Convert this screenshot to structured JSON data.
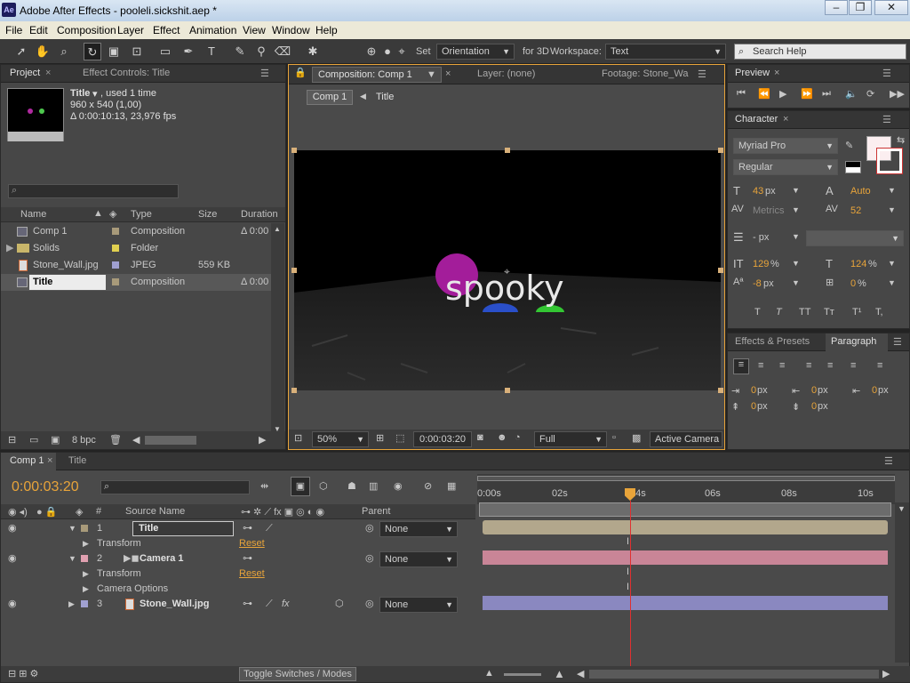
{
  "window": {
    "title": "Adobe After Effects - pooleli.sickshit.aep *",
    "logo": "Ae"
  },
  "menu": [
    "File",
    "Edit",
    "Composition",
    "Layer",
    "Effect",
    "Animation",
    "View",
    "Window",
    "Help"
  ],
  "toolbar": {
    "set_label": "Set",
    "orientation": "Orientation",
    "for3d_label": "for 3D",
    "workspace_label": "Workspace:",
    "workspace": "Text",
    "search_placeholder": "Search Help"
  },
  "project_panel": {
    "tab_project": "Project",
    "tab_effect": "Effect Controls: Title",
    "item_name": "Title",
    "item_used": ", used 1 time",
    "item_dims": "960 x 540 (1,00)",
    "item_dur": "Δ 0:00:10:13, 23,976 fps",
    "columns": [
      "Name",
      "Type",
      "Size",
      "Duration"
    ],
    "rows": [
      {
        "name": "Comp 1",
        "type": "Composition",
        "size": "",
        "duration": "Δ 0:00",
        "color": "#a89a7a",
        "icon": "comp"
      },
      {
        "name": "Solids",
        "type": "Folder",
        "size": "",
        "duration": "",
        "color": "#e0d050",
        "icon": "folder"
      },
      {
        "name": "Stone_Wall.jpg",
        "type": "JPEG",
        "size": "559 KB",
        "duration": "",
        "color": "#a0a0d0",
        "icon": "jpeg"
      },
      {
        "name": "Title",
        "type": "Composition",
        "size": "",
        "duration": "Δ 0:00",
        "color": "#a89a7a",
        "icon": "comp"
      }
    ],
    "bpc": "8 bpc"
  },
  "comp_panel": {
    "tab_comp": "Composition: Comp 1",
    "tab_layer": "Layer: (none)",
    "tab_footage": "Footage: Stone_Wa",
    "breadcrumb_comp": "Comp 1",
    "breadcrumb_title": "Title",
    "viewer_text": "spooky",
    "zoom": "50%",
    "timecode": "0:00:03:20",
    "resolution": "Full",
    "camera": "Active Camera"
  },
  "preview_panel": {
    "tab": "Preview"
  },
  "character_panel": {
    "tab": "Character",
    "font": "Myriad Pro",
    "style": "Regular",
    "size": "43",
    "size_unit": "px",
    "leading": "Auto",
    "kerning": "Metrics",
    "tracking": "52",
    "stroke_unit": "- px",
    "vscale": "129",
    "hscale": "124",
    "baseline": "-8",
    "baseline_unit": "px",
    "tsume": "0",
    "pct": "%",
    "format_buttons": [
      "T",
      "T",
      "TT",
      "Tт",
      "T¹",
      "T,"
    ]
  },
  "effects_panel": {
    "tab_effects": "Effects & Presets",
    "tab_paragraph": "Paragraph",
    "indent_left": "0",
    "indent_right": "0",
    "indent_first": "0",
    "space_before": "0",
    "space_after": "0",
    "unit": "px"
  },
  "timeline": {
    "tab_comp": "Comp 1",
    "tab_title": "Title",
    "timecode": "0:00:03:20",
    "ruler": [
      "0:00s",
      "02s",
      "04s",
      "06s",
      "08s",
      "10s"
    ],
    "col_num": "#",
    "col_source": "Source Name",
    "col_parent": "Parent",
    "layers": [
      {
        "num": "1",
        "name": "Title",
        "parent": "None",
        "color": "#a89a7a",
        "bar": "#b2a78c"
      },
      {
        "num": "2",
        "name": "Camera 1",
        "parent": "None",
        "color": "#e0a0b0",
        "bar": "#c98597"
      },
      {
        "num": "3",
        "name": "Stone_Wall.jpg",
        "parent": "None",
        "color": "#a0a0d0",
        "bar": "#8a88c0"
      }
    ],
    "transform": "Transform",
    "reset": "Reset",
    "camera_options": "Camera Options",
    "toggle": "Toggle Switches / Modes"
  }
}
